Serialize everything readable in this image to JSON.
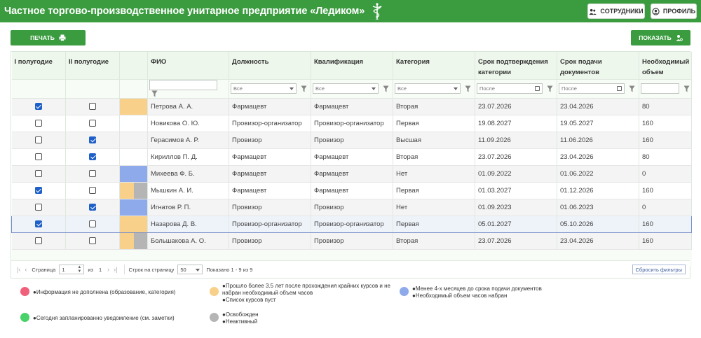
{
  "header": {
    "title": "Частное торгово-производственное унитарное предприятие «Ледиком»",
    "employees_label": "СОТРУДНИКИ",
    "profile_label": "ПРОФИЛЬ"
  },
  "actions": {
    "print_label": "ПЕЧАТЬ",
    "show_label": "ПОКАЗАТЬ"
  },
  "columns": [
    "I полугодие",
    "II полугодие",
    "",
    "ФИО",
    "Должность",
    "Квалификация",
    "Категория",
    "Срок подтверждения категории",
    "Срок подачи документов",
    "Необходимый объем"
  ],
  "filters": {
    "all": "Все",
    "after": "После"
  },
  "colors": {
    "red": "#f0607a",
    "yellow": "#f8d08a",
    "blue": "#8eaaea",
    "green": "#49d16a",
    "gray": "#b5b5b5",
    "brand": "#3a9c3f"
  },
  "rows": [
    {
      "h1": true,
      "h2": false,
      "marks": [
        "yellow"
      ],
      "name": "Петрова А. А.",
      "position": "Фармацевт",
      "qualification": "Фармацевт",
      "category": "Вторая",
      "confirm": "23.07.2026",
      "submit": "23.04.2026",
      "volume": "80"
    },
    {
      "h1": false,
      "h2": false,
      "marks": [],
      "name": "Новикова О. Ю.",
      "position": "Провизор-организатор",
      "qualification": "Провизор-организатор",
      "category": "Первая",
      "confirm": "19.08.2027",
      "submit": "19.05.2027",
      "volume": "160"
    },
    {
      "h1": false,
      "h2": true,
      "marks": [],
      "name": "Герасимов А. Р.",
      "position": "Провизор",
      "qualification": "Провизор",
      "category": "Высшая",
      "confirm": "11.09.2026",
      "submit": "11.06.2026",
      "volume": "160"
    },
    {
      "h1": false,
      "h2": true,
      "marks": [],
      "name": "Кириллов П. Д.",
      "position": "Фармацевт",
      "qualification": "Фармацевт",
      "category": "Вторая",
      "confirm": "23.07.2026",
      "submit": "23.04.2026",
      "volume": "80"
    },
    {
      "h1": false,
      "h2": false,
      "marks": [
        "blue"
      ],
      "name": "Михеева Ф. Б.",
      "position": "Фармацевт",
      "qualification": "Фармацевт",
      "category": "Нет",
      "confirm": "01.09.2022",
      "submit": "01.06.2022",
      "volume": "0"
    },
    {
      "h1": true,
      "h2": false,
      "marks": [
        "yellow",
        "gray"
      ],
      "name": "Мышкин А. И.",
      "position": "Фармацевт",
      "qualification": "Фармацевт",
      "category": "Первая",
      "confirm": "01.03.2027",
      "submit": "01.12.2026",
      "volume": "160"
    },
    {
      "h1": false,
      "h2": true,
      "marks": [
        "blue"
      ],
      "name": "Игнатов Р. П.",
      "position": "Провизор",
      "qualification": "Провизор",
      "category": "Нет",
      "confirm": "01.09.2023",
      "submit": "01.06.2023",
      "volume": "0"
    },
    {
      "h1": true,
      "h2": false,
      "marks": [
        "yellow"
      ],
      "name": "Назарова Д. В.",
      "position": "Провизор-организатор",
      "qualification": "Провизор-организатор",
      "category": "Первая",
      "confirm": "05.01.2027",
      "submit": "05.10.2026",
      "volume": "160",
      "selected": true
    },
    {
      "h1": false,
      "h2": false,
      "marks": [
        "yellow",
        "gray"
      ],
      "name": "Большакова А. О.",
      "position": "Провизор",
      "qualification": "Провизор",
      "category": "Вторая",
      "confirm": "23.07.2026",
      "submit": "23.04.2026",
      "volume": "160"
    }
  ],
  "pager": {
    "page_label": "Страница",
    "page_value": "1",
    "of_label": "из",
    "total_pages": "1",
    "rows_per_page_label": "Строк на страницу",
    "rows_per_page_value": "50",
    "shown": "Показано 1 - 9 из 9",
    "reset_label": "Сбросить фильтры"
  },
  "legend": {
    "red": "●Информация не дополнена (образование, категория)",
    "yellow_1": "●Прошло более 3.5 лет после прохождения крайних курсов и не набран необходимый объем часов",
    "yellow_2": "●Список курсов пуст",
    "blue_1": "●Менее 4-х месяцев до срока подачи документов",
    "blue_2": "●Необходимый объем часов набран",
    "green": "●Сегодня запланированно уведомление (см. заметки)",
    "gray_1": "●Освобожден",
    "gray_2": "●Неактивный"
  }
}
